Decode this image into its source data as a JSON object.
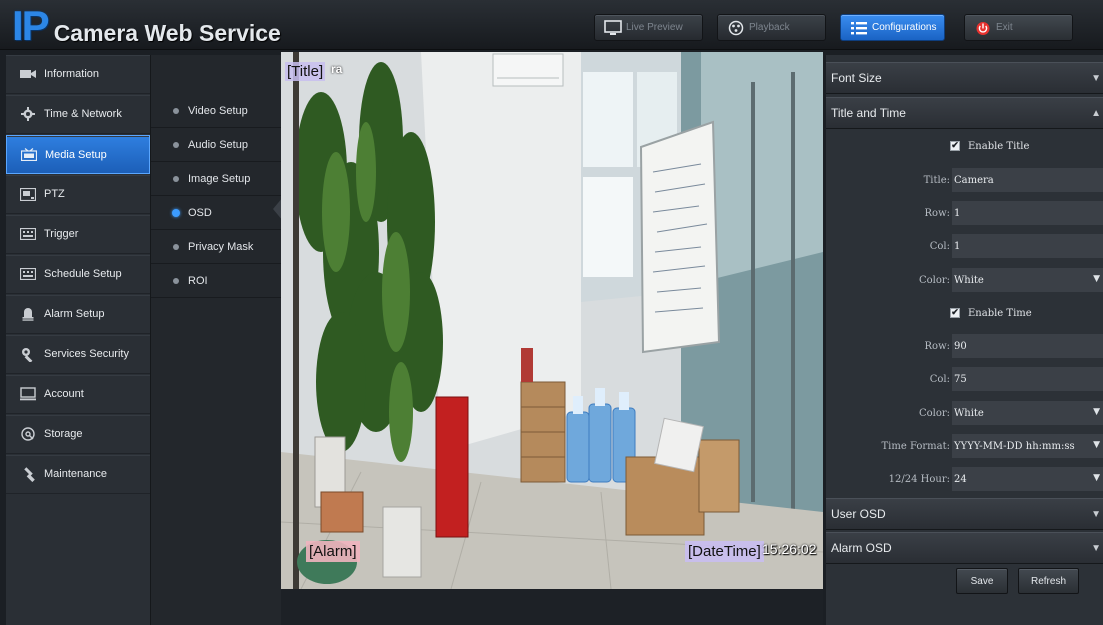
{
  "app": {
    "logo_ip": "IP",
    "logo_text": "Camera Web Service"
  },
  "topnav": [
    {
      "label": "Live Preview",
      "icon": "monitor-icon"
    },
    {
      "label": "Playback",
      "icon": "playback-icon"
    },
    {
      "label": "Configurations",
      "icon": "list-icon",
      "active": true
    },
    {
      "label": "Exit",
      "icon": "power-icon"
    }
  ],
  "sidebar": {
    "items": [
      {
        "label": "Information",
        "icon": "camera-icon"
      },
      {
        "label": "Time & Network",
        "icon": "gear-icon"
      },
      {
        "label": "Media Setup",
        "icon": "media-icon",
        "active": true
      },
      {
        "label": "PTZ",
        "icon": "ptz-icon"
      },
      {
        "label": "Trigger",
        "icon": "trigger-icon"
      },
      {
        "label": "Schedule Setup",
        "icon": "schedule-icon"
      },
      {
        "label": "Alarm Setup",
        "icon": "bell-icon"
      },
      {
        "label": "Services Security",
        "icon": "wrench-icon"
      },
      {
        "label": "Account",
        "icon": "monitor-icon"
      },
      {
        "label": "Storage",
        "icon": "storage-icon"
      },
      {
        "label": "Maintenance",
        "icon": "tools-icon"
      }
    ]
  },
  "submenu": {
    "items": [
      {
        "label": "Video Setup"
      },
      {
        "label": "Audio Setup"
      },
      {
        "label": "Image Setup"
      },
      {
        "label": "OSD",
        "active": true
      },
      {
        "label": "Privacy Mask"
      },
      {
        "label": "ROI"
      }
    ]
  },
  "video": {
    "osd_title": "[Title]",
    "osd_title_overlay": "ra",
    "osd_alarm": "[Alarm]",
    "osd_datetime": "[DateTime]",
    "osd_clock": "15:26:02"
  },
  "settings": {
    "font_size": {
      "label": "Font Size"
    },
    "title_time": {
      "label": "Title and Time",
      "enable_title": "Enable Title",
      "title": {
        "label": "Title:",
        "value": "Camera"
      },
      "title_row": {
        "label": "Row:",
        "value": "1"
      },
      "title_col": {
        "label": "Col:",
        "value": "1"
      },
      "title_color": {
        "label": "Color:",
        "value": "White"
      },
      "enable_time": "Enable Time",
      "time_row": {
        "label": "Row:",
        "value": "90"
      },
      "time_col": {
        "label": "Col:",
        "value": "75"
      },
      "time_color": {
        "label": "Color:",
        "value": "White"
      },
      "time_format": {
        "label": "Time Format:",
        "value": "YYYY-MM-DD hh:mm:ss"
      },
      "hour_format": {
        "label": "12/24 Hour:",
        "value": "24"
      }
    },
    "user_osd": {
      "label": "User OSD"
    },
    "alarm_osd": {
      "label": "Alarm OSD"
    },
    "save_label": "Save",
    "refresh_label": "Refresh"
  },
  "colors": {
    "accent": "#2c86e6",
    "active_nav": "#1f66c4",
    "panel_bg": "#2c3137",
    "sidebar_bg": "#2a2f35"
  }
}
